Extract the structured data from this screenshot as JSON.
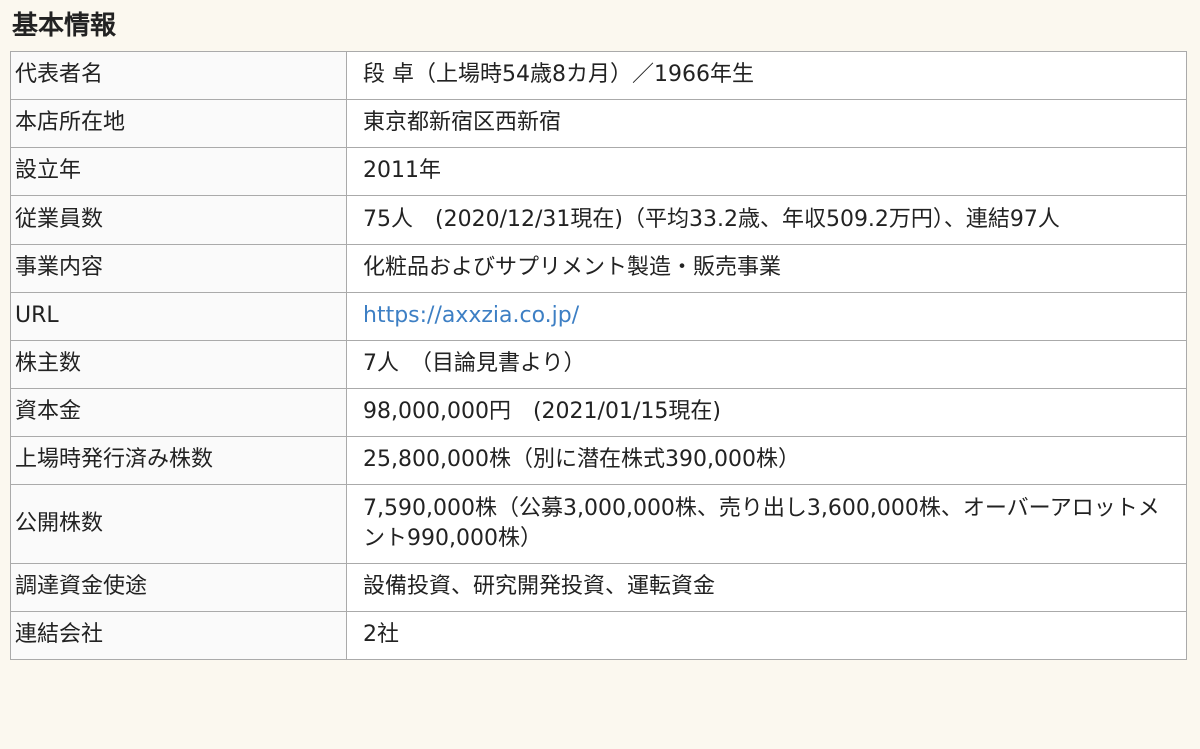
{
  "title": "基本情報",
  "rows": [
    {
      "label": "代表者名",
      "value": "段 卓（上場時54歳8カ月）／1966年生"
    },
    {
      "label": "本店所在地",
      "value": "東京都新宿区西新宿"
    },
    {
      "label": "設立年",
      "value": "2011年"
    },
    {
      "label": "従業員数",
      "value": "75人　(2020/12/31現在)（平均33.2歳、年収509.2万円）、連結97人"
    },
    {
      "label": "事業内容",
      "value": "化粧品およびサプリメント製造・販売事業"
    },
    {
      "label": "URL",
      "value": "https://axxzia.co.jp/"
    },
    {
      "label": "株主数",
      "value": "7人　（目論見書より）"
    },
    {
      "label": "資本金",
      "value": "98,000,000円　(2021/01/15現在)"
    },
    {
      "label": "上場時発行済み株数",
      "value": "25,800,000株（別に潜在株式390,000株）"
    },
    {
      "label": "公開株数",
      "value": "7,590,000株（公募3,000,000株、売り出し3,600,000株、オーバーアロットメント990,000株）"
    },
    {
      "label": "調達資金使途",
      "value": "設備投資、研究開発投資、運転資金"
    },
    {
      "label": "連結会社",
      "value": "2社"
    }
  ]
}
